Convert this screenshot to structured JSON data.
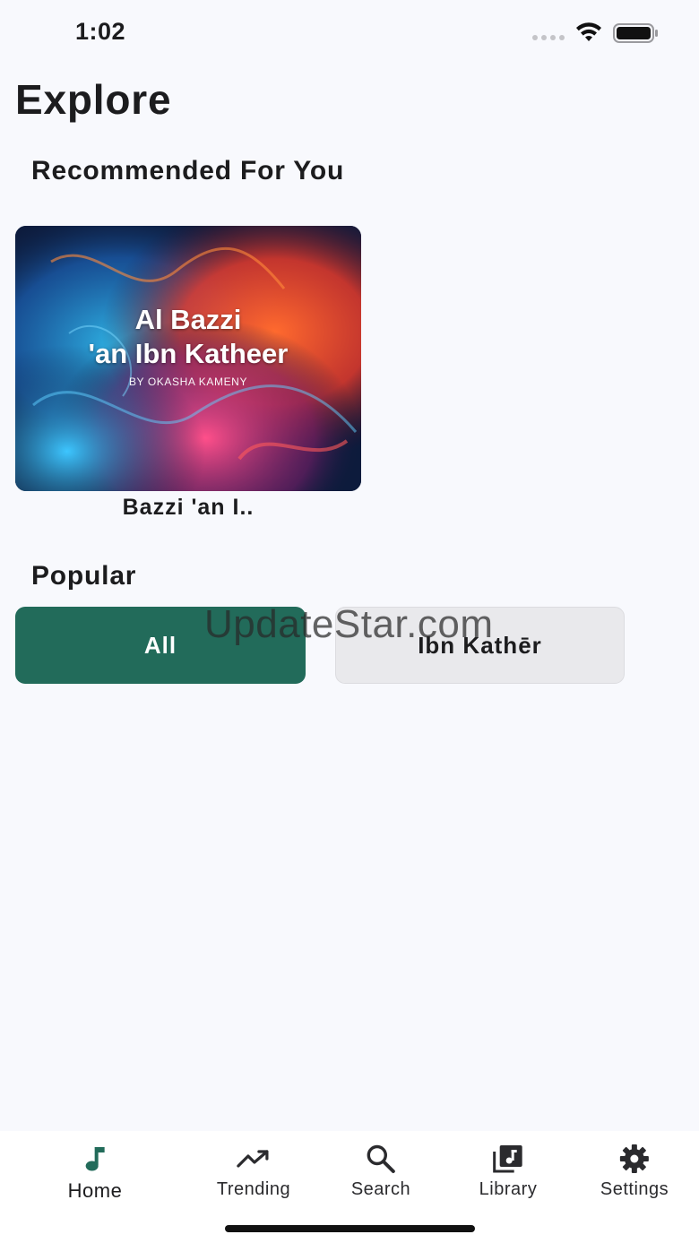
{
  "status_bar": {
    "time": "1:02"
  },
  "page": {
    "title": "Explore"
  },
  "recommended": {
    "title": "Recommended For You",
    "items": [
      {
        "art_title_line1": "Al Bazzi",
        "art_title_line2": "'an Ibn Katheer",
        "art_byline": "BY OKASHA KAMENY",
        "label": "Bazzi 'an I.."
      }
    ]
  },
  "popular": {
    "title": "Popular",
    "chips": [
      {
        "label": "All",
        "selected": true
      },
      {
        "label": "Ibn Kathēr",
        "selected": false
      }
    ]
  },
  "watermark": "UpdateStar.com",
  "tabbar": {
    "items": [
      {
        "label": "Home",
        "icon": "music-note-icon",
        "active": true
      },
      {
        "label": "Trending",
        "icon": "trending-up-icon",
        "active": false
      },
      {
        "label": "Search",
        "icon": "search-icon",
        "active": false
      },
      {
        "label": "Library",
        "icon": "library-music-icon",
        "active": false
      },
      {
        "label": "Settings",
        "icon": "gear-icon",
        "active": false
      }
    ]
  },
  "colors": {
    "background": "#f8f9fd",
    "accent": "#226b5a",
    "chip_inactive": "#e9e9ec",
    "text": "#1c1c1e"
  }
}
